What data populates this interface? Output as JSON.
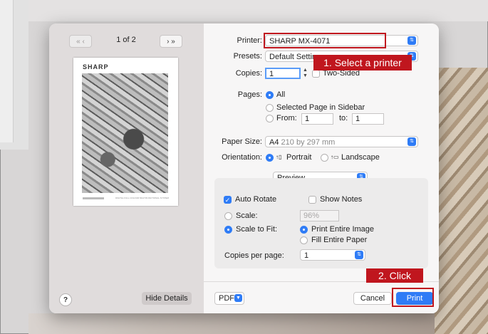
{
  "preview": {
    "page_indicator": "1 of 2",
    "brand": "SHARP",
    "footer_caption": "DIGITAL FULL COLOUR MULTIFUNCTIONAL SYSTEM"
  },
  "sidebar": {
    "help_label": "?",
    "hide_details_label": "Hide Details"
  },
  "printer": {
    "label": "Printer:",
    "value": "SHARP MX-4071"
  },
  "presets": {
    "label": "Presets:",
    "value": "Default Settings"
  },
  "copies": {
    "label": "Copies:",
    "value": "1",
    "two_sided_label": "Two-Sided"
  },
  "pages": {
    "label": "Pages:",
    "all_label": "All",
    "selected_label": "Selected Page in Sidebar",
    "from_label": "From:",
    "from_value": "1",
    "to_label": "to:",
    "to_value": "1"
  },
  "paper_size": {
    "label": "Paper Size:",
    "value": "A4",
    "detail": "210 by 297 mm"
  },
  "orientation": {
    "label": "Orientation:",
    "portrait_label": "Portrait",
    "landscape_label": "Landscape"
  },
  "section": {
    "value": "Preview"
  },
  "options": {
    "auto_rotate_label": "Auto Rotate",
    "show_notes_label": "Show Notes",
    "scale_label": "Scale:",
    "scale_value": "96%",
    "scale_to_fit_label": "Scale to Fit:",
    "print_entire_image_label": "Print Entire Image",
    "fill_entire_paper_label": "Fill Entire Paper",
    "copies_per_page_label": "Copies per page:",
    "copies_per_page_value": "1"
  },
  "footer": {
    "pdf_label": "PDF",
    "cancel_label": "Cancel",
    "print_label": "Print"
  },
  "annotations": {
    "step1": "1. Select a printer",
    "step2": "2. Click"
  },
  "colors": {
    "accent": "#2f7cf6",
    "callout": "#c0161e"
  }
}
